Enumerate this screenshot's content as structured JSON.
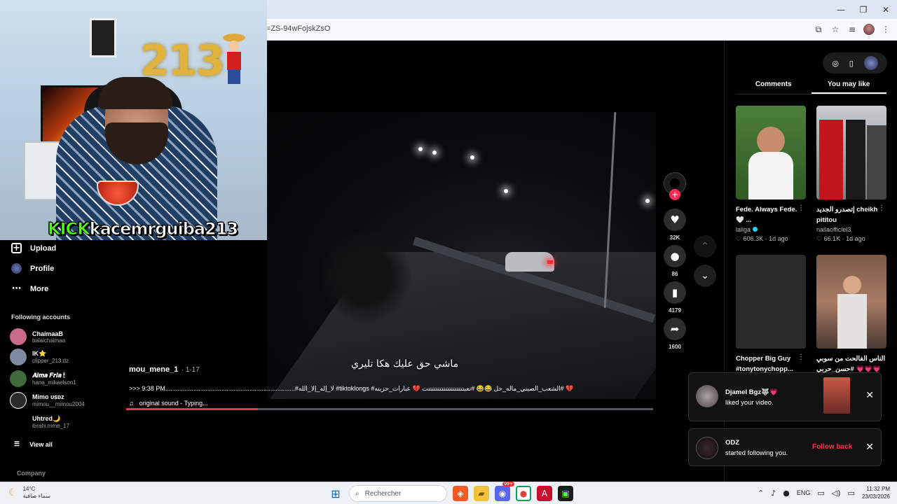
{
  "browser": {
    "url": "=ZS-94wFojskZsO",
    "window_controls": [
      "—",
      "❐",
      "✕"
    ]
  },
  "webcam": {
    "balloon_text": "213",
    "kick_label": "KICK",
    "streamer": "kacemrguiba213"
  },
  "sidebar": {
    "nav": [
      {
        "label": "Upload",
        "icon": "upload-icon"
      },
      {
        "label": "Profile",
        "icon": "profile-icon"
      },
      {
        "label": "More",
        "icon": "more-icon"
      }
    ],
    "following_title": "Following accounts",
    "accounts": [
      {
        "name": "ChaimaaB",
        "handle": "balaichaimaa",
        "color": "#c96a86"
      },
      {
        "name": "IK⭐",
        "handle": "clipper_213.dz",
        "color": "#7d8aa0"
      },
      {
        "name": "𝑨𝒍𝒎𝒂 𝑭𝒓𝒊𝒂 🕯",
        "handle": "hana_mikaelson1",
        "color": "#3f6a3a"
      },
      {
        "name": "Mimo ᴜꜱᴅᴢ",
        "handle": "mimou__mimou2004",
        "color": "#2a2a2a"
      },
      {
        "name": "Uhtred🌙",
        "handle": "ibrahi.mme_17",
        "color": "#000000"
      }
    ],
    "view_all": "View all",
    "company": "Company"
  },
  "video": {
    "caption": "ماشي حق عليك هكا تليري",
    "username": "mou_mene_1",
    "date": "· 1-17",
    "description": "9:38 PM..........................................................................#لا_إله_إلا_الله #tiktoklongs #الشعب_الصيني_ماله_حل 😂😂 #تعبتتتتتتتتتتتتتتتتتتتت 💔 عبارات_حزينه# 💔",
    "description_prefix": ">>>",
    "sound": "original sound - Typing...",
    "progress": 0.25
  },
  "actions": {
    "likes": "32K",
    "comments": "86",
    "saves": "4179",
    "shares": "1600"
  },
  "right_panel": {
    "tabs": [
      "Comments",
      "You may like"
    ],
    "active_tab": "You may like",
    "cards": [
      {
        "title": "Fede. Always Fede. 🤍 ...",
        "author": "laliga",
        "verified": true,
        "likes": "♡ 606.3K",
        "age": "· 1d ago"
      },
      {
        "title": "إتصدرو الجديد cheikh pititou",
        "author": "nailaofficiel3",
        "verified": false,
        "likes": "♡ 66.1K",
        "age": "· 1d ago"
      },
      {
        "title": "Chopper Big Guy #tonytonychopp...",
        "author": "",
        "verified": false,
        "likes": "",
        "age": ""
      },
      {
        "title": "الناس الفالحت من سوبي #حسن_حربي 💗💗💗",
        "author": "",
        "verified": false,
        "likes": "",
        "age": ""
      }
    ]
  },
  "notifications": [
    {
      "name": "Djamel Bgz🐺💗",
      "text": "liked your video."
    },
    {
      "name": "ODZ",
      "text": "started following you.",
      "action": "Follow back"
    }
  ],
  "taskbar": {
    "temp": "14°C",
    "weather": "سماء صافية",
    "search": "Rechercher",
    "lang": "ENG",
    "time": "11:32 PM",
    "date": "23/03/2026",
    "badge": "99+"
  }
}
